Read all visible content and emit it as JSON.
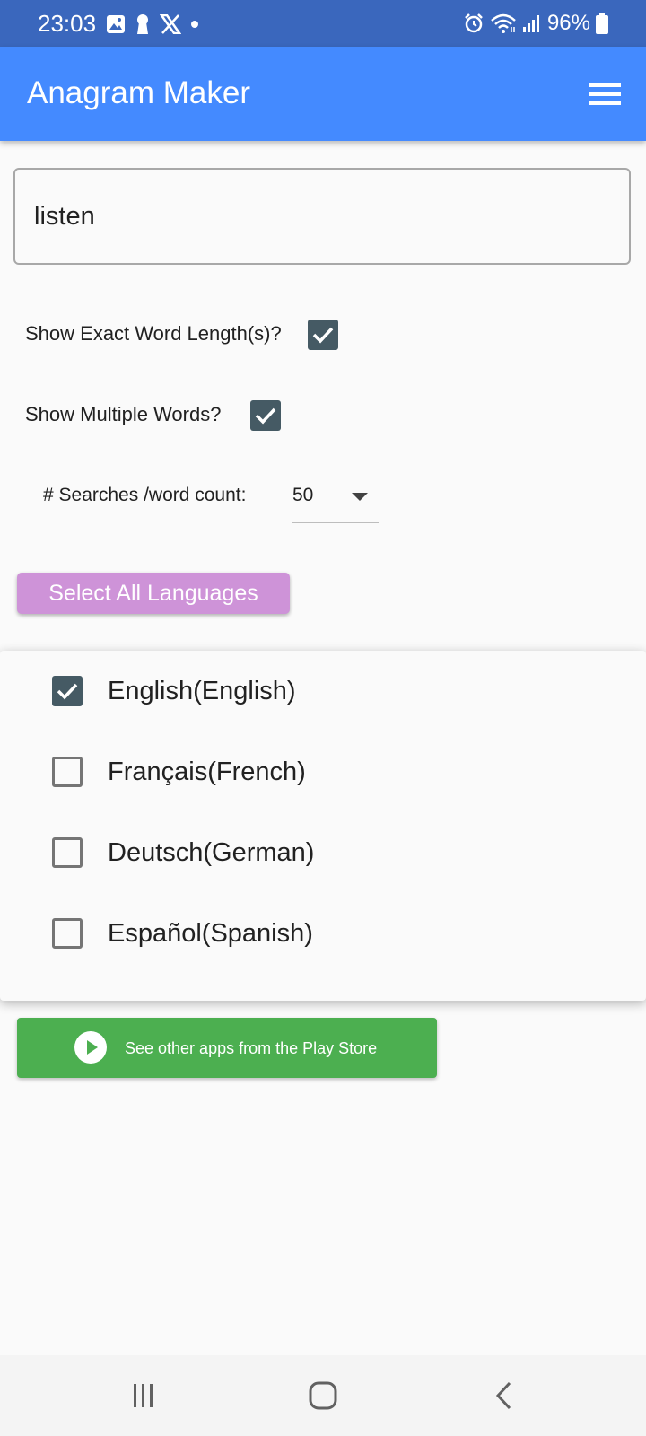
{
  "status_bar": {
    "time": "23:03",
    "battery": "96%",
    "icons": [
      "gallery-icon",
      "keyhole-icon",
      "x-logo-icon",
      "dot-icon",
      "alarm-icon",
      "wifi-icon",
      "signal-icon",
      "battery-icon"
    ]
  },
  "app_bar": {
    "title": "Anagram Maker",
    "menu_icon": "hamburger-menu-icon"
  },
  "word_input": {
    "value": "listen"
  },
  "options": {
    "exact_length_label": "Show Exact Word Length(s)?",
    "exact_length_checked": true,
    "multiple_words_label": "Show Multiple Words?",
    "multiple_words_checked": true,
    "searches_label": "# Searches /word count:",
    "searches_value": "50"
  },
  "select_all_button": {
    "label": "Select All Languages",
    "color": "#ce93d8"
  },
  "languages": [
    {
      "label": "English(English)",
      "checked": true
    },
    {
      "label": "Français(French)",
      "checked": false
    },
    {
      "label": "Deutsch(German)",
      "checked": false
    },
    {
      "label": "Español(Spanish)",
      "checked": false
    }
  ],
  "play_store_button": {
    "label": "See other apps from the Play Store",
    "color": "#4caf50",
    "icon": "play-circle-icon"
  },
  "nav_bar": {
    "icons": [
      "recent-apps-icon",
      "home-icon",
      "back-icon"
    ]
  },
  "colors": {
    "status_bar": "#3a67bd",
    "app_bar": "#448aff",
    "checkbox_checked": "#455a64"
  }
}
